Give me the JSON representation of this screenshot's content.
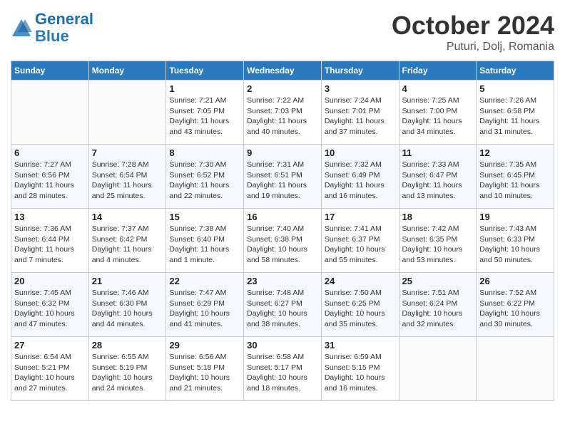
{
  "header": {
    "logo_line1": "General",
    "logo_line2": "Blue",
    "month": "October 2024",
    "location": "Puturi, Dolj, Romania"
  },
  "weekdays": [
    "Sunday",
    "Monday",
    "Tuesday",
    "Wednesday",
    "Thursday",
    "Friday",
    "Saturday"
  ],
  "weeks": [
    [
      {
        "day": "",
        "sunrise": "",
        "sunset": "",
        "daylight": ""
      },
      {
        "day": "",
        "sunrise": "",
        "sunset": "",
        "daylight": ""
      },
      {
        "day": "1",
        "sunrise": "Sunrise: 7:21 AM",
        "sunset": "Sunset: 7:05 PM",
        "daylight": "Daylight: 11 hours and 43 minutes."
      },
      {
        "day": "2",
        "sunrise": "Sunrise: 7:22 AM",
        "sunset": "Sunset: 7:03 PM",
        "daylight": "Daylight: 11 hours and 40 minutes."
      },
      {
        "day": "3",
        "sunrise": "Sunrise: 7:24 AM",
        "sunset": "Sunset: 7:01 PM",
        "daylight": "Daylight: 11 hours and 37 minutes."
      },
      {
        "day": "4",
        "sunrise": "Sunrise: 7:25 AM",
        "sunset": "Sunset: 7:00 PM",
        "daylight": "Daylight: 11 hours and 34 minutes."
      },
      {
        "day": "5",
        "sunrise": "Sunrise: 7:26 AM",
        "sunset": "Sunset: 6:58 PM",
        "daylight": "Daylight: 11 hours and 31 minutes."
      }
    ],
    [
      {
        "day": "6",
        "sunrise": "Sunrise: 7:27 AM",
        "sunset": "Sunset: 6:56 PM",
        "daylight": "Daylight: 11 hours and 28 minutes."
      },
      {
        "day": "7",
        "sunrise": "Sunrise: 7:28 AM",
        "sunset": "Sunset: 6:54 PM",
        "daylight": "Daylight: 11 hours and 25 minutes."
      },
      {
        "day": "8",
        "sunrise": "Sunrise: 7:30 AM",
        "sunset": "Sunset: 6:52 PM",
        "daylight": "Daylight: 11 hours and 22 minutes."
      },
      {
        "day": "9",
        "sunrise": "Sunrise: 7:31 AM",
        "sunset": "Sunset: 6:51 PM",
        "daylight": "Daylight: 11 hours and 19 minutes."
      },
      {
        "day": "10",
        "sunrise": "Sunrise: 7:32 AM",
        "sunset": "Sunset: 6:49 PM",
        "daylight": "Daylight: 11 hours and 16 minutes."
      },
      {
        "day": "11",
        "sunrise": "Sunrise: 7:33 AM",
        "sunset": "Sunset: 6:47 PM",
        "daylight": "Daylight: 11 hours and 13 minutes."
      },
      {
        "day": "12",
        "sunrise": "Sunrise: 7:35 AM",
        "sunset": "Sunset: 6:45 PM",
        "daylight": "Daylight: 11 hours and 10 minutes."
      }
    ],
    [
      {
        "day": "13",
        "sunrise": "Sunrise: 7:36 AM",
        "sunset": "Sunset: 6:44 PM",
        "daylight": "Daylight: 11 hours and 7 minutes."
      },
      {
        "day": "14",
        "sunrise": "Sunrise: 7:37 AM",
        "sunset": "Sunset: 6:42 PM",
        "daylight": "Daylight: 11 hours and 4 minutes."
      },
      {
        "day": "15",
        "sunrise": "Sunrise: 7:38 AM",
        "sunset": "Sunset: 6:40 PM",
        "daylight": "Daylight: 11 hours and 1 minute."
      },
      {
        "day": "16",
        "sunrise": "Sunrise: 7:40 AM",
        "sunset": "Sunset: 6:38 PM",
        "daylight": "Daylight: 10 hours and 58 minutes."
      },
      {
        "day": "17",
        "sunrise": "Sunrise: 7:41 AM",
        "sunset": "Sunset: 6:37 PM",
        "daylight": "Daylight: 10 hours and 55 minutes."
      },
      {
        "day": "18",
        "sunrise": "Sunrise: 7:42 AM",
        "sunset": "Sunset: 6:35 PM",
        "daylight": "Daylight: 10 hours and 53 minutes."
      },
      {
        "day": "19",
        "sunrise": "Sunrise: 7:43 AM",
        "sunset": "Sunset: 6:33 PM",
        "daylight": "Daylight: 10 hours and 50 minutes."
      }
    ],
    [
      {
        "day": "20",
        "sunrise": "Sunrise: 7:45 AM",
        "sunset": "Sunset: 6:32 PM",
        "daylight": "Daylight: 10 hours and 47 minutes."
      },
      {
        "day": "21",
        "sunrise": "Sunrise: 7:46 AM",
        "sunset": "Sunset: 6:30 PM",
        "daylight": "Daylight: 10 hours and 44 minutes."
      },
      {
        "day": "22",
        "sunrise": "Sunrise: 7:47 AM",
        "sunset": "Sunset: 6:29 PM",
        "daylight": "Daylight: 10 hours and 41 minutes."
      },
      {
        "day": "23",
        "sunrise": "Sunrise: 7:48 AM",
        "sunset": "Sunset: 6:27 PM",
        "daylight": "Daylight: 10 hours and 38 minutes."
      },
      {
        "day": "24",
        "sunrise": "Sunrise: 7:50 AM",
        "sunset": "Sunset: 6:25 PM",
        "daylight": "Daylight: 10 hours and 35 minutes."
      },
      {
        "day": "25",
        "sunrise": "Sunrise: 7:51 AM",
        "sunset": "Sunset: 6:24 PM",
        "daylight": "Daylight: 10 hours and 32 minutes."
      },
      {
        "day": "26",
        "sunrise": "Sunrise: 7:52 AM",
        "sunset": "Sunset: 6:22 PM",
        "daylight": "Daylight: 10 hours and 30 minutes."
      }
    ],
    [
      {
        "day": "27",
        "sunrise": "Sunrise: 6:54 AM",
        "sunset": "Sunset: 5:21 PM",
        "daylight": "Daylight: 10 hours and 27 minutes."
      },
      {
        "day": "28",
        "sunrise": "Sunrise: 6:55 AM",
        "sunset": "Sunset: 5:19 PM",
        "daylight": "Daylight: 10 hours and 24 minutes."
      },
      {
        "day": "29",
        "sunrise": "Sunrise: 6:56 AM",
        "sunset": "Sunset: 5:18 PM",
        "daylight": "Daylight: 10 hours and 21 minutes."
      },
      {
        "day": "30",
        "sunrise": "Sunrise: 6:58 AM",
        "sunset": "Sunset: 5:17 PM",
        "daylight": "Daylight: 10 hours and 18 minutes."
      },
      {
        "day": "31",
        "sunrise": "Sunrise: 6:59 AM",
        "sunset": "Sunset: 5:15 PM",
        "daylight": "Daylight: 10 hours and 16 minutes."
      },
      {
        "day": "",
        "sunrise": "",
        "sunset": "",
        "daylight": ""
      },
      {
        "day": "",
        "sunrise": "",
        "sunset": "",
        "daylight": ""
      }
    ]
  ]
}
